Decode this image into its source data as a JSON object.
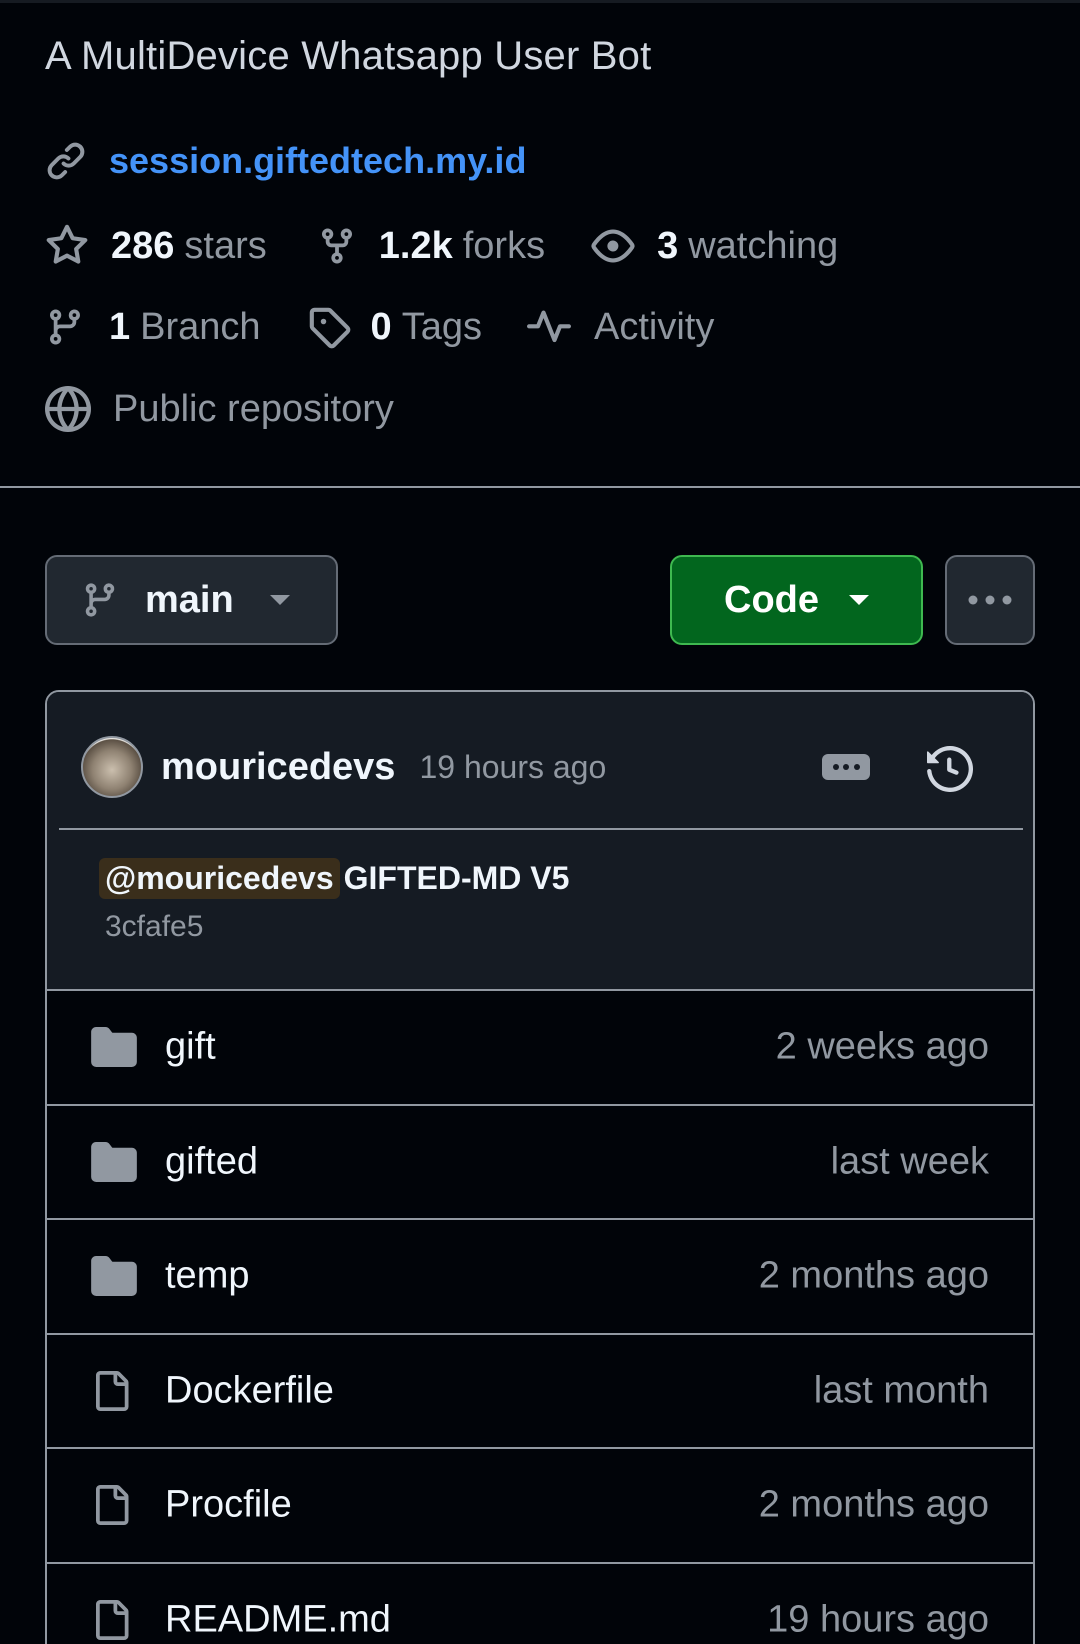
{
  "repo": {
    "description": "A MultiDevice Whatsapp User Bot",
    "website": "session.giftedtech.my.id",
    "stats": {
      "stars_count": "286",
      "stars_label": "stars",
      "forks_count": "1.2k",
      "forks_label": "forks",
      "watching_count": "3",
      "watching_label": "watching"
    },
    "meta": {
      "branch_count": "1",
      "branch_label": "Branch",
      "tags_count": "0",
      "tags_label": "Tags",
      "activity_label": "Activity",
      "visibility_label": "Public repository"
    }
  },
  "toolbar": {
    "branch_name": "main",
    "code_label": "Code"
  },
  "commit": {
    "author": "mouricedevs",
    "time_ago": "19 hours ago",
    "mention": "@mouricedevs",
    "message": "GIFTED-MD V5",
    "sha": "3cfafe5"
  },
  "files": [
    {
      "name": "gift",
      "type": "folder",
      "updated": "2 weeks ago"
    },
    {
      "name": "gifted",
      "type": "folder",
      "updated": "last week"
    },
    {
      "name": "temp",
      "type": "folder",
      "updated": "2 months ago"
    },
    {
      "name": "Dockerfile",
      "type": "file",
      "updated": "last month"
    },
    {
      "name": "Procfile",
      "type": "file",
      "updated": "2 months ago"
    },
    {
      "name": "README.md",
      "type": "file",
      "updated": "19 hours ago"
    }
  ],
  "colors": {
    "background": "#010409",
    "link": "#4493f8",
    "code_button": "#02661e",
    "muted": "#9198a1"
  }
}
